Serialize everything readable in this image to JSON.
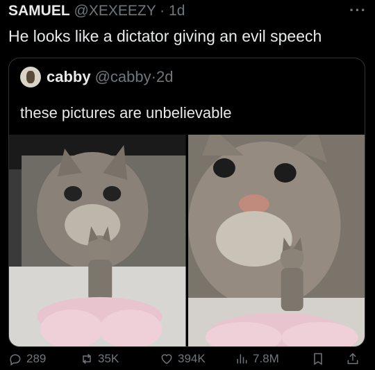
{
  "tweet": {
    "author_name": "SAMUEL",
    "author_handle": "@XEXEEZY",
    "separator": "·",
    "time": "1d",
    "more_label": "···",
    "text": "He looks like a dictator giving an evil speech"
  },
  "quoted": {
    "author_name": "cabby",
    "author_handle": "@cabby",
    "separator": "·",
    "time": "2d",
    "text": "these pictures are unbelievable",
    "images": [
      {
        "icon": "cat-photo-1"
      },
      {
        "icon": "cat-photo-2"
      }
    ]
  },
  "actions": {
    "replies": "289",
    "reposts": "35K",
    "likes": "394K",
    "views": "7.8M"
  },
  "colors": {
    "background": "#000000",
    "text": "#e7e9ea",
    "muted": "#71767b",
    "border": "#2f3336"
  }
}
